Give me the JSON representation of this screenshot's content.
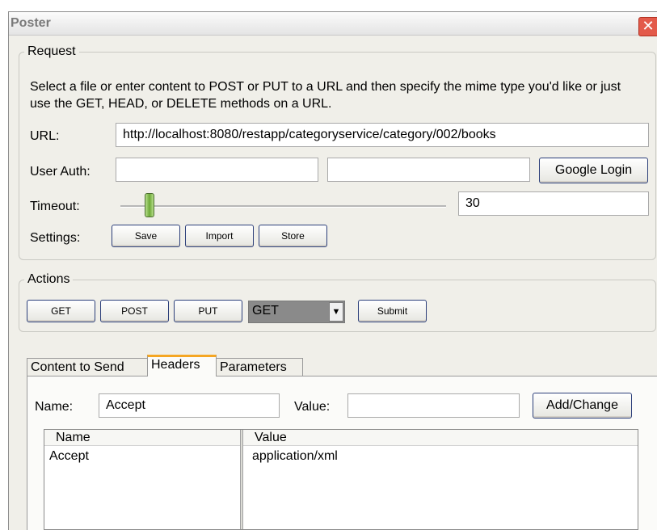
{
  "window": {
    "title": "Poster",
    "close_glyph": "✕"
  },
  "request": {
    "legend": "Request",
    "description": "Select a file or enter content to POST or PUT to a URL and then specify the mime type you'd like or just use the GET, HEAD, or DELETE methods on a URL.",
    "url_label": "URL:",
    "url_value": "http://localhost:8080/restapp/categoryservice/category/002/books",
    "user_auth_label": "User Auth:",
    "user_auth_user": "",
    "user_auth_pass": "",
    "google_login_label": "Google Login",
    "timeout_label": "Timeout:",
    "timeout_value": "30",
    "settings_label": "Settings:",
    "save_label": "Save",
    "import_label": "Import",
    "store_label": "Store"
  },
  "actions": {
    "legend": "Actions",
    "get_label": "GET",
    "post_label": "POST",
    "put_label": "PUT",
    "method_selected": "GET",
    "submit_label": "Submit"
  },
  "tabs": [
    {
      "label": "Content to Send",
      "active": false
    },
    {
      "label": "Headers",
      "active": true
    },
    {
      "label": "Parameters",
      "active": false
    }
  ],
  "headers": {
    "name_label": "Name:",
    "name_value": "Accept",
    "value_label": "Value:",
    "value_value": "",
    "add_change_label": "Add/Change",
    "columns": [
      "Name",
      "Value"
    ],
    "rows": [
      {
        "name": "Accept",
        "value": "application/xml"
      }
    ]
  },
  "colors": {
    "tab_accent": "#f5a623",
    "close_red": "#e35a4a",
    "slider_green": "#6da838"
  },
  "icons": {
    "close": "close-icon",
    "dropdown": "chevron-down-icon"
  }
}
